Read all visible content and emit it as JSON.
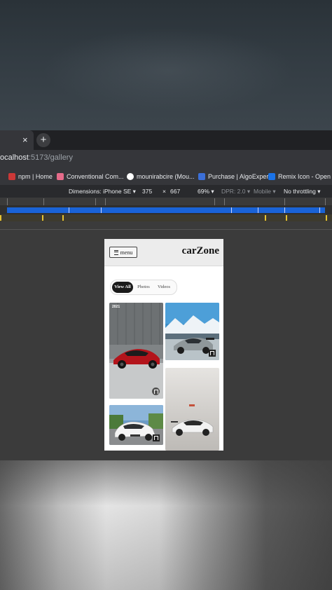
{
  "browser": {
    "tab_close": "×",
    "new_tab": "+",
    "url_host": "ocalhost",
    "url_path": ":5173/gallery",
    "bookmarks": [
      {
        "label": "npm | Home",
        "icon": "npm-icon",
        "color": "#cb3837"
      },
      {
        "label": "Conventional Com...",
        "icon": "conventional-icon",
        "color": "#e66b8a"
      },
      {
        "label": "mounirabcire (Mou...",
        "icon": "github-icon",
        "color": "#ffffff"
      },
      {
        "label": "Purchase | AlgoExpert",
        "icon": "algoexpert-icon",
        "color": "#3b6fd8"
      },
      {
        "label": "Remix Icon - Open s...",
        "icon": "remix-icon",
        "color": "#1a73e8"
      }
    ]
  },
  "devtools": {
    "dimensions_label": "Dimensions: iPhone SE ▾",
    "width": "375",
    "times": "×",
    "height": "667",
    "zoom": "69% ▾",
    "dpr": "DPR: 2.0 ▾",
    "mode": "Mobile ▾",
    "throttling": "No throttling ▾"
  },
  "app": {
    "menu_label": "menu",
    "brand": "carZone",
    "filters": [
      "View All",
      "Photos",
      "Videos"
    ],
    "active_filter": "View All",
    "gallery": [
      {
        "name": "red-supercar-photo",
        "badge": "2021"
      },
      {
        "name": "porsche-snow-photo",
        "badge": ""
      },
      {
        "name": "white-gtr-photo",
        "badge": ""
      },
      {
        "name": "white-peugeot-photo",
        "badge": ""
      }
    ]
  },
  "colors": {
    "accent_blue": "#1a63d6",
    "active_chip": "#1a1a1a"
  }
}
